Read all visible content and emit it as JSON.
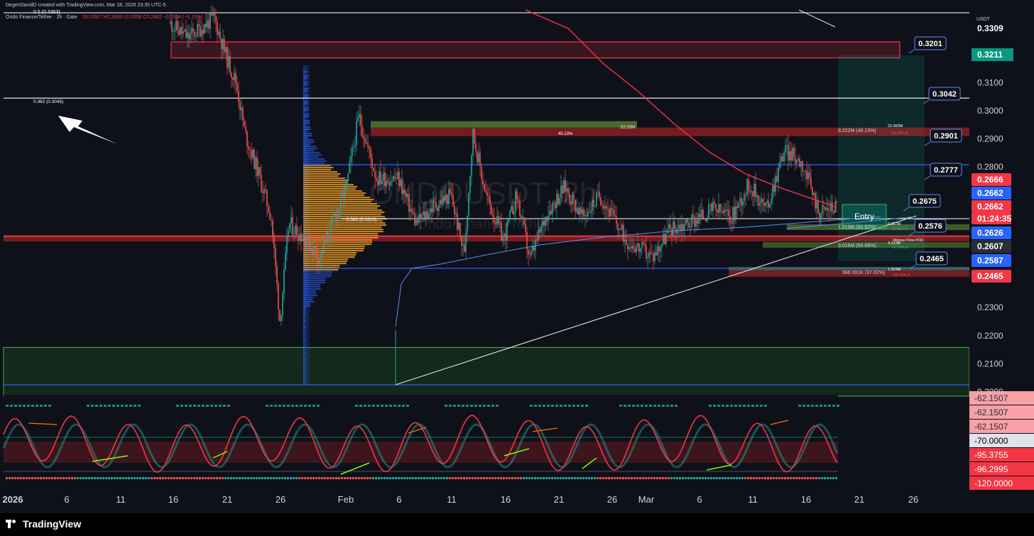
{
  "header": {
    "created": "DegenDavidD created with TradingView.com, Mar 18, 2026 23:35 UTC-5",
    "symbol_line": "Ondo Finance/Tether · 2h · Gate",
    "ohlc": "O0.2667  H0.2669  L0.2658  C0.2662  −0.0004 (−0.15%)",
    "fib_top": "0.5 (0.3363)"
  },
  "watermark": {
    "symbol": "ONDOUSDT, 2h",
    "name": "Ondo Finance/Tether"
  },
  "currency": "USDT",
  "colors": {
    "bg": "#0f111a",
    "up": "#26a69a",
    "down": "#ef5350",
    "red_line": "#f23645",
    "blue_line": "#2962ff",
    "green_zone": "#1b5e20"
  },
  "annotations": {
    "fib_0382_left": "0.382 (0.3045)",
    "fib_0382_mid": "0.382 (0.2619)",
    "entry": "Entry",
    "pct_5233": "52.33%",
    "pct_4013": "40.13%",
    "vol_1": "9.222M (40.13%)",
    "vol_1b": "22.983M",
    "vol_1c": "12.39% Δ",
    "vol_2": "1.219M (60.82%)",
    "vol_2b": "6.037M",
    "vol_2c": "22.55% Δ",
    "vol_3": "3.015M (69.89%)",
    "vol_3b": "4.313M",
    "vol_3c": "79.79% Δ",
    "vol_4": "686.001K (37.62%)",
    "vol_4b": "1.824M",
    "vol_4c": "−24.76% Δ",
    "poc": "Money Flow POC"
  },
  "callouts": [
    "0.3201",
    "0.3042",
    "0.2901",
    "0.2777",
    "0.2675",
    "0.2576",
    "0.2465"
  ],
  "price_axis": {
    "ticks": [
      "0.3309",
      "0.3100",
      "0.3000",
      "0.2900",
      "0.2800",
      "0.2300",
      "0.2200",
      "0.2100",
      "0.2000"
    ],
    "tick_values": [
      0.3309,
      0.31,
      0.3,
      0.29,
      0.28,
      0.23,
      0.22,
      0.21,
      0.2
    ],
    "badges": [
      {
        "text": "0.3211",
        "value": 0.3211,
        "color": "#089981"
      },
      {
        "text": "0.2666",
        "value": 0.2666,
        "color": "#f23645"
      },
      {
        "text": "0.2662",
        "value": 0.2662,
        "color": "#2962ff"
      },
      {
        "text": "0.2662",
        "value": 0.26575,
        "color": "#f23645"
      },
      {
        "text": "01:24:35",
        "value": 0.26475,
        "color": "#f23645"
      },
      {
        "text": "0.2626",
        "value": 0.2626,
        "color": "#2962ff"
      },
      {
        "text": "0.2607",
        "value": 0.2607,
        "color": "#2a2e39"
      },
      {
        "text": "0.2587",
        "value": 0.2587,
        "color": "#2962ff"
      },
      {
        "text": "0.2465",
        "value": 0.2465,
        "color": "#f23645"
      }
    ]
  },
  "osc_axis": [
    {
      "text": "-62.1507",
      "color": "#f7a1a6"
    },
    {
      "text": "-62.1507",
      "color": "#f7a1a6"
    },
    {
      "text": "-62.1507",
      "color": "#f7a1a6"
    },
    {
      "text": "-70.0000",
      "color": "#e0e3eb"
    },
    {
      "text": "-95.3755",
      "color": "#f23645"
    },
    {
      "text": "-96.2995",
      "color": "#f23645"
    },
    {
      "text": "-120.0000",
      "color": "#f23645"
    }
  ],
  "time_axis": [
    "2026",
    "6",
    "11",
    "16",
    "21",
    "26",
    "Feb",
    "6",
    "11",
    "16",
    "21",
    "26",
    "Mar",
    "6",
    "11",
    "16",
    "21",
    "26"
  ],
  "brand": "TradingView",
  "chart_data": {
    "type": "candlestick",
    "symbol": "ONDOUSDT",
    "timeframe": "2h",
    "exchange": "Gate",
    "y_range": [
      0.2,
      0.335
    ],
    "ohlc_last": {
      "open": 0.2667,
      "high": 0.2669,
      "low": 0.2658,
      "close": 0.2662,
      "change": -0.0004,
      "change_pct": -0.15
    },
    "fib_levels": [
      {
        "ratio": 0.5,
        "price": 0.3363
      },
      {
        "ratio": 0.382,
        "price": 0.3045
      },
      {
        "ratio": 0.382,
        "price": 0.2619
      }
    ],
    "horizontal_levels": [
      0.3042,
      0.2777,
      0.2576,
      0.2465,
      0.2011
    ],
    "target_levels": [
      0.3201,
      0.2901,
      0.2675
    ],
    "zones": [
      {
        "kind": "supply",
        "top": 0.3245,
        "bottom": 0.3188
      },
      {
        "kind": "demand",
        "top": 0.2158,
        "bottom": 0.1985
      },
      {
        "kind": "resistance",
        "top": 0.2963,
        "bottom": 0.2925
      }
    ],
    "path": [
      {
        "x": 0,
        "y": 0.3309
      },
      {
        "x": 0.02,
        "y": 0.326
      },
      {
        "x": 0.05,
        "y": 0.333
      },
      {
        "x": 0.065,
        "y": 0.318
      },
      {
        "x": 0.075,
        "y": 0.31
      },
      {
        "x": 0.085,
        "y": 0.292
      },
      {
        "x": 0.1,
        "y": 0.278
      },
      {
        "x": 0.115,
        "y": 0.262
      },
      {
        "x": 0.125,
        "y": 0.225
      },
      {
        "x": 0.135,
        "y": 0.26
      },
      {
        "x": 0.155,
        "y": 0.254
      },
      {
        "x": 0.17,
        "y": 0.248
      },
      {
        "x": 0.2,
        "y": 0.272
      },
      {
        "x": 0.215,
        "y": 0.298
      },
      {
        "x": 0.235,
        "y": 0.276
      },
      {
        "x": 0.26,
        "y": 0.276
      },
      {
        "x": 0.28,
        "y": 0.26
      },
      {
        "x": 0.3,
        "y": 0.266
      },
      {
        "x": 0.32,
        "y": 0.27
      },
      {
        "x": 0.335,
        "y": 0.249
      },
      {
        "x": 0.345,
        "y": 0.292
      },
      {
        "x": 0.36,
        "y": 0.27
      },
      {
        "x": 0.38,
        "y": 0.254
      },
      {
        "x": 0.395,
        "y": 0.27
      },
      {
        "x": 0.41,
        "y": 0.247
      },
      {
        "x": 0.43,
        "y": 0.264
      },
      {
        "x": 0.45,
        "y": 0.273
      },
      {
        "x": 0.47,
        "y": 0.262
      },
      {
        "x": 0.49,
        "y": 0.27
      },
      {
        "x": 0.52,
        "y": 0.254
      },
      {
        "x": 0.55,
        "y": 0.248
      },
      {
        "x": 0.57,
        "y": 0.258
      },
      {
        "x": 0.59,
        "y": 0.26
      },
      {
        "x": 0.62,
        "y": 0.265
      },
      {
        "x": 0.64,
        "y": 0.262
      },
      {
        "x": 0.66,
        "y": 0.274
      },
      {
        "x": 0.68,
        "y": 0.265
      },
      {
        "x": 0.7,
        "y": 0.286
      },
      {
        "x": 0.72,
        "y": 0.282
      },
      {
        "x": 0.74,
        "y": 0.264
      },
      {
        "x": 0.76,
        "y": 0.2665
      }
    ]
  }
}
